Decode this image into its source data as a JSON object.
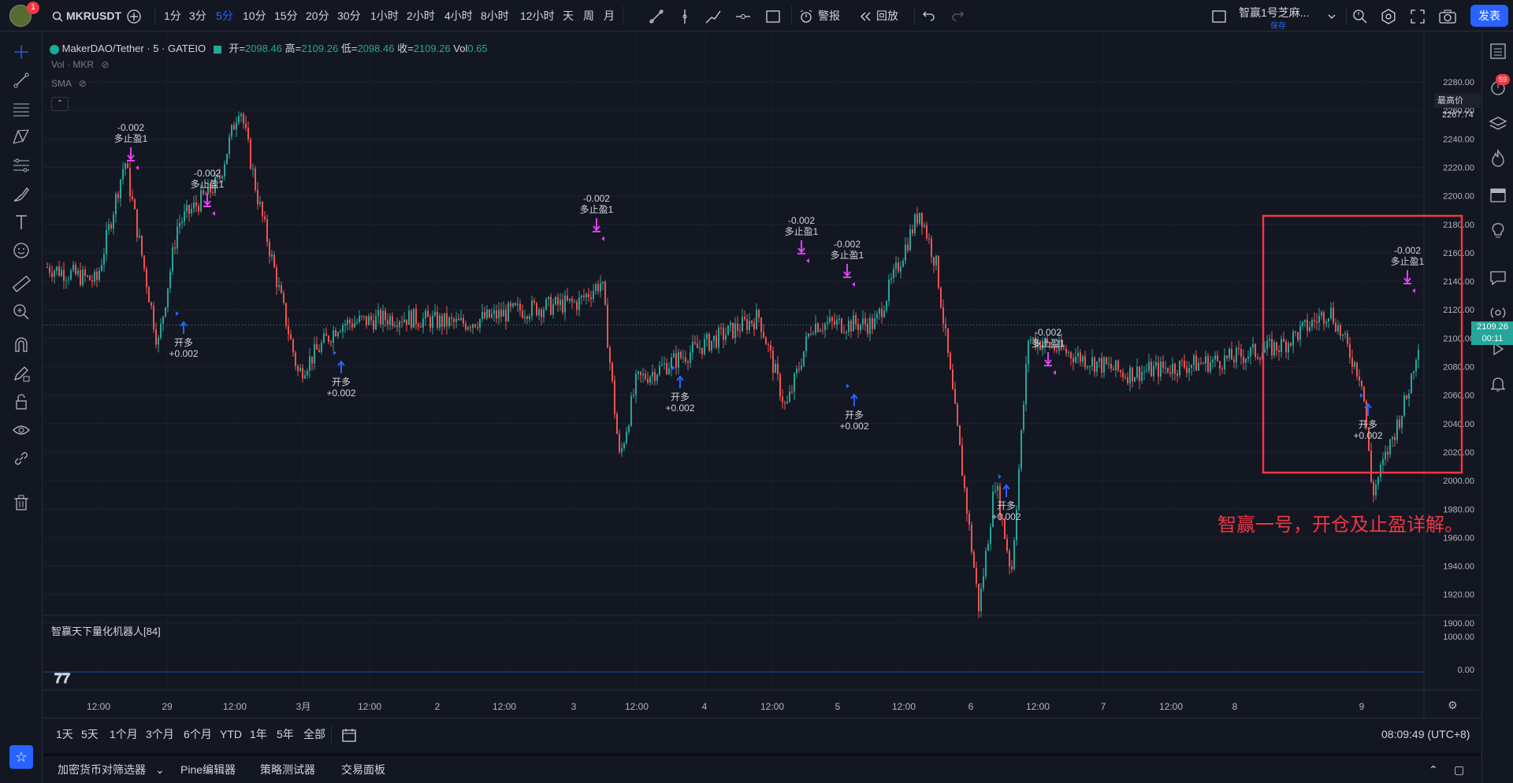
{
  "topbar": {
    "avatar_badge": "1",
    "symbol": "MKRUSDT",
    "intervals": [
      "1分",
      "3分",
      "5分",
      "10分",
      "15分",
      "20分",
      "30分",
      "1小时",
      "2小时",
      "4小时",
      "8小时",
      "12小时",
      "天",
      "周",
      "月"
    ],
    "active_interval": "5分",
    "alert_label": "警报",
    "replay_label": "回放",
    "layout_name": "智赢1号芝麻...",
    "layout_status": "保存",
    "publish_label": "发表"
  },
  "legend": {
    "title": "MakerDAO/Tether · 5 · GATEIO",
    "open_label": "开=",
    "open": "2098.46",
    "high_label": "高=",
    "high": "2109.26",
    "low_label": "低=",
    "low": "2098.46",
    "close_label": "收=",
    "close": "2109.26",
    "vol_label": "Vol",
    "vol": "0.65",
    "sub1": "Vol · MKR",
    "sub2": "SMA",
    "indicator_pane": "智赢天下量化机器人[84]"
  },
  "price_axis": {
    "labels": [
      "2280.00",
      "2260.00",
      "2240.00",
      "2220.00",
      "2200.00",
      "2180.00",
      "2160.00",
      "2140.00",
      "2120.00",
      "2100.00",
      "2080.00",
      "2060.00",
      "2040.00",
      "2020.00",
      "2000.00",
      "1980.00",
      "1960.00",
      "1940.00",
      "1920.00",
      "1900.00"
    ],
    "indicator_labels": [
      "1000.00",
      "0.00"
    ],
    "high_tag_label": "最高价",
    "high_tag_value": "2267.74",
    "current_price": "2109.26",
    "countdown": "00:11"
  },
  "time_axis": [
    "12:00",
    "29",
    "12:00",
    "3月",
    "12:00",
    "2",
    "12:00",
    "3",
    "12:00",
    "4",
    "12:00",
    "5",
    "12:00",
    "6",
    "12:00",
    "7",
    "12:00",
    "8",
    "9"
  ],
  "annotations": [
    {
      "line1": "-0.002",
      "line2": "多止盈1",
      "type": "tp"
    },
    {
      "line1": "-0.002",
      "line2": "多止盈1",
      "type": "tp"
    },
    {
      "line1": "开多",
      "line2": "+0.002",
      "type": "entry"
    },
    {
      "line1": "开多",
      "line2": "+0.002",
      "type": "entry"
    },
    {
      "line1": "-0.002",
      "line2": "多止盈1",
      "type": "tp"
    },
    {
      "line1": "开多",
      "line2": "+0.002",
      "type": "entry"
    },
    {
      "line1": "-0.002",
      "line2": "多止盈1",
      "type": "tp"
    },
    {
      "line1": "-0.002",
      "line2": "多止盈1",
      "type": "tp"
    },
    {
      "line1": "开多",
      "line2": "+0.002",
      "type": "entry"
    },
    {
      "line1": "开多",
      "line2": "+0.002",
      "type": "entry"
    },
    {
      "line1": "-0.002",
      "line2": "多止盈1",
      "type": "tp"
    },
    {
      "line1": "开多",
      "line2": "+0.002",
      "type": "entry"
    },
    {
      "line1": "-0.002",
      "line2": "多止盈1",
      "type": "tp"
    }
  ],
  "overlay_text": "智赢一号，开仓及止盈详解。",
  "range_bar": {
    "ranges": [
      "1天",
      "5天",
      "1个月",
      "3个月",
      "6个月",
      "YTD",
      "1年",
      "5年",
      "全部"
    ],
    "clock": "08:09:49 (UTC+8)"
  },
  "bottom_tabs": [
    "加密货币对筛选器",
    "Pine编辑器",
    "策略测试器",
    "交易面板"
  ],
  "right_badge": "59",
  "colors": {
    "background": "#131722",
    "up": "#26a69a",
    "down": "#ef5350",
    "accent": "#2962ff",
    "tp_marker": "#e040fb",
    "entry_marker": "#2962ff",
    "highlight_box": "#f23645"
  },
  "chart_data": {
    "type": "candlestick",
    "symbol": "MKRUSDT",
    "interval": "5",
    "ylim": [
      1880,
      2290
    ],
    "key_points": [
      {
        "t": "28 09:00",
        "price": 2150
      },
      {
        "t": "28 12:00",
        "price": 2140
      },
      {
        "t": "28 22:00",
        "price": 2225
      },
      {
        "t": "29 02:00",
        "price": 2095
      },
      {
        "t": "29 06:00",
        "price": 2180
      },
      {
        "t": "29 12:00",
        "price": 2210
      },
      {
        "t": "29 16:00",
        "price": 2265
      },
      {
        "t": "29 19:00",
        "price": 2200
      },
      {
        "t": "3月 01:00",
        "price": 2075
      },
      {
        "t": "3月 06:00",
        "price": 2110
      },
      {
        "t": "3月 12:00",
        "price": 2115
      },
      {
        "t": "2 00:00",
        "price": 2110
      },
      {
        "t": "2 12:00",
        "price": 2120
      },
      {
        "t": "3 06:00",
        "price": 2125
      },
      {
        "t": "3 14:00",
        "price": 2140
      },
      {
        "t": "3 18:00",
        "price": 2015
      },
      {
        "t": "3 21:00",
        "price": 2070
      },
      {
        "t": "4 12:00",
        "price": 2095
      },
      {
        "t": "5 00:00",
        "price": 2115
      },
      {
        "t": "5 04:00",
        "price": 2050
      },
      {
        "t": "5 08:00",
        "price": 2110
      },
      {
        "t": "5 13:00",
        "price": 2110
      },
      {
        "t": "5 18:00",
        "price": 2190
      },
      {
        "t": "5 22:00",
        "price": 2150
      },
      {
        "t": "6 02:00",
        "price": 2020
      },
      {
        "t": "6 06:00",
        "price": 1910
      },
      {
        "t": "6 08:00",
        "price": 2000
      },
      {
        "t": "6 10:00",
        "price": 1935
      },
      {
        "t": "6 14:00",
        "price": 2100
      },
      {
        "t": "7 00:00",
        "price": 2075
      },
      {
        "t": "7 12:00",
        "price": 2085
      },
      {
        "t": "8 00:00",
        "price": 2095
      },
      {
        "t": "8 08:00",
        "price": 2120
      },
      {
        "t": "8 16:00",
        "price": 2070
      },
      {
        "t": "9 01:00",
        "price": 1990
      },
      {
        "t": "9 05:00",
        "price": 2060
      },
      {
        "t": "9 08:00",
        "price": 2109.26
      }
    ]
  }
}
